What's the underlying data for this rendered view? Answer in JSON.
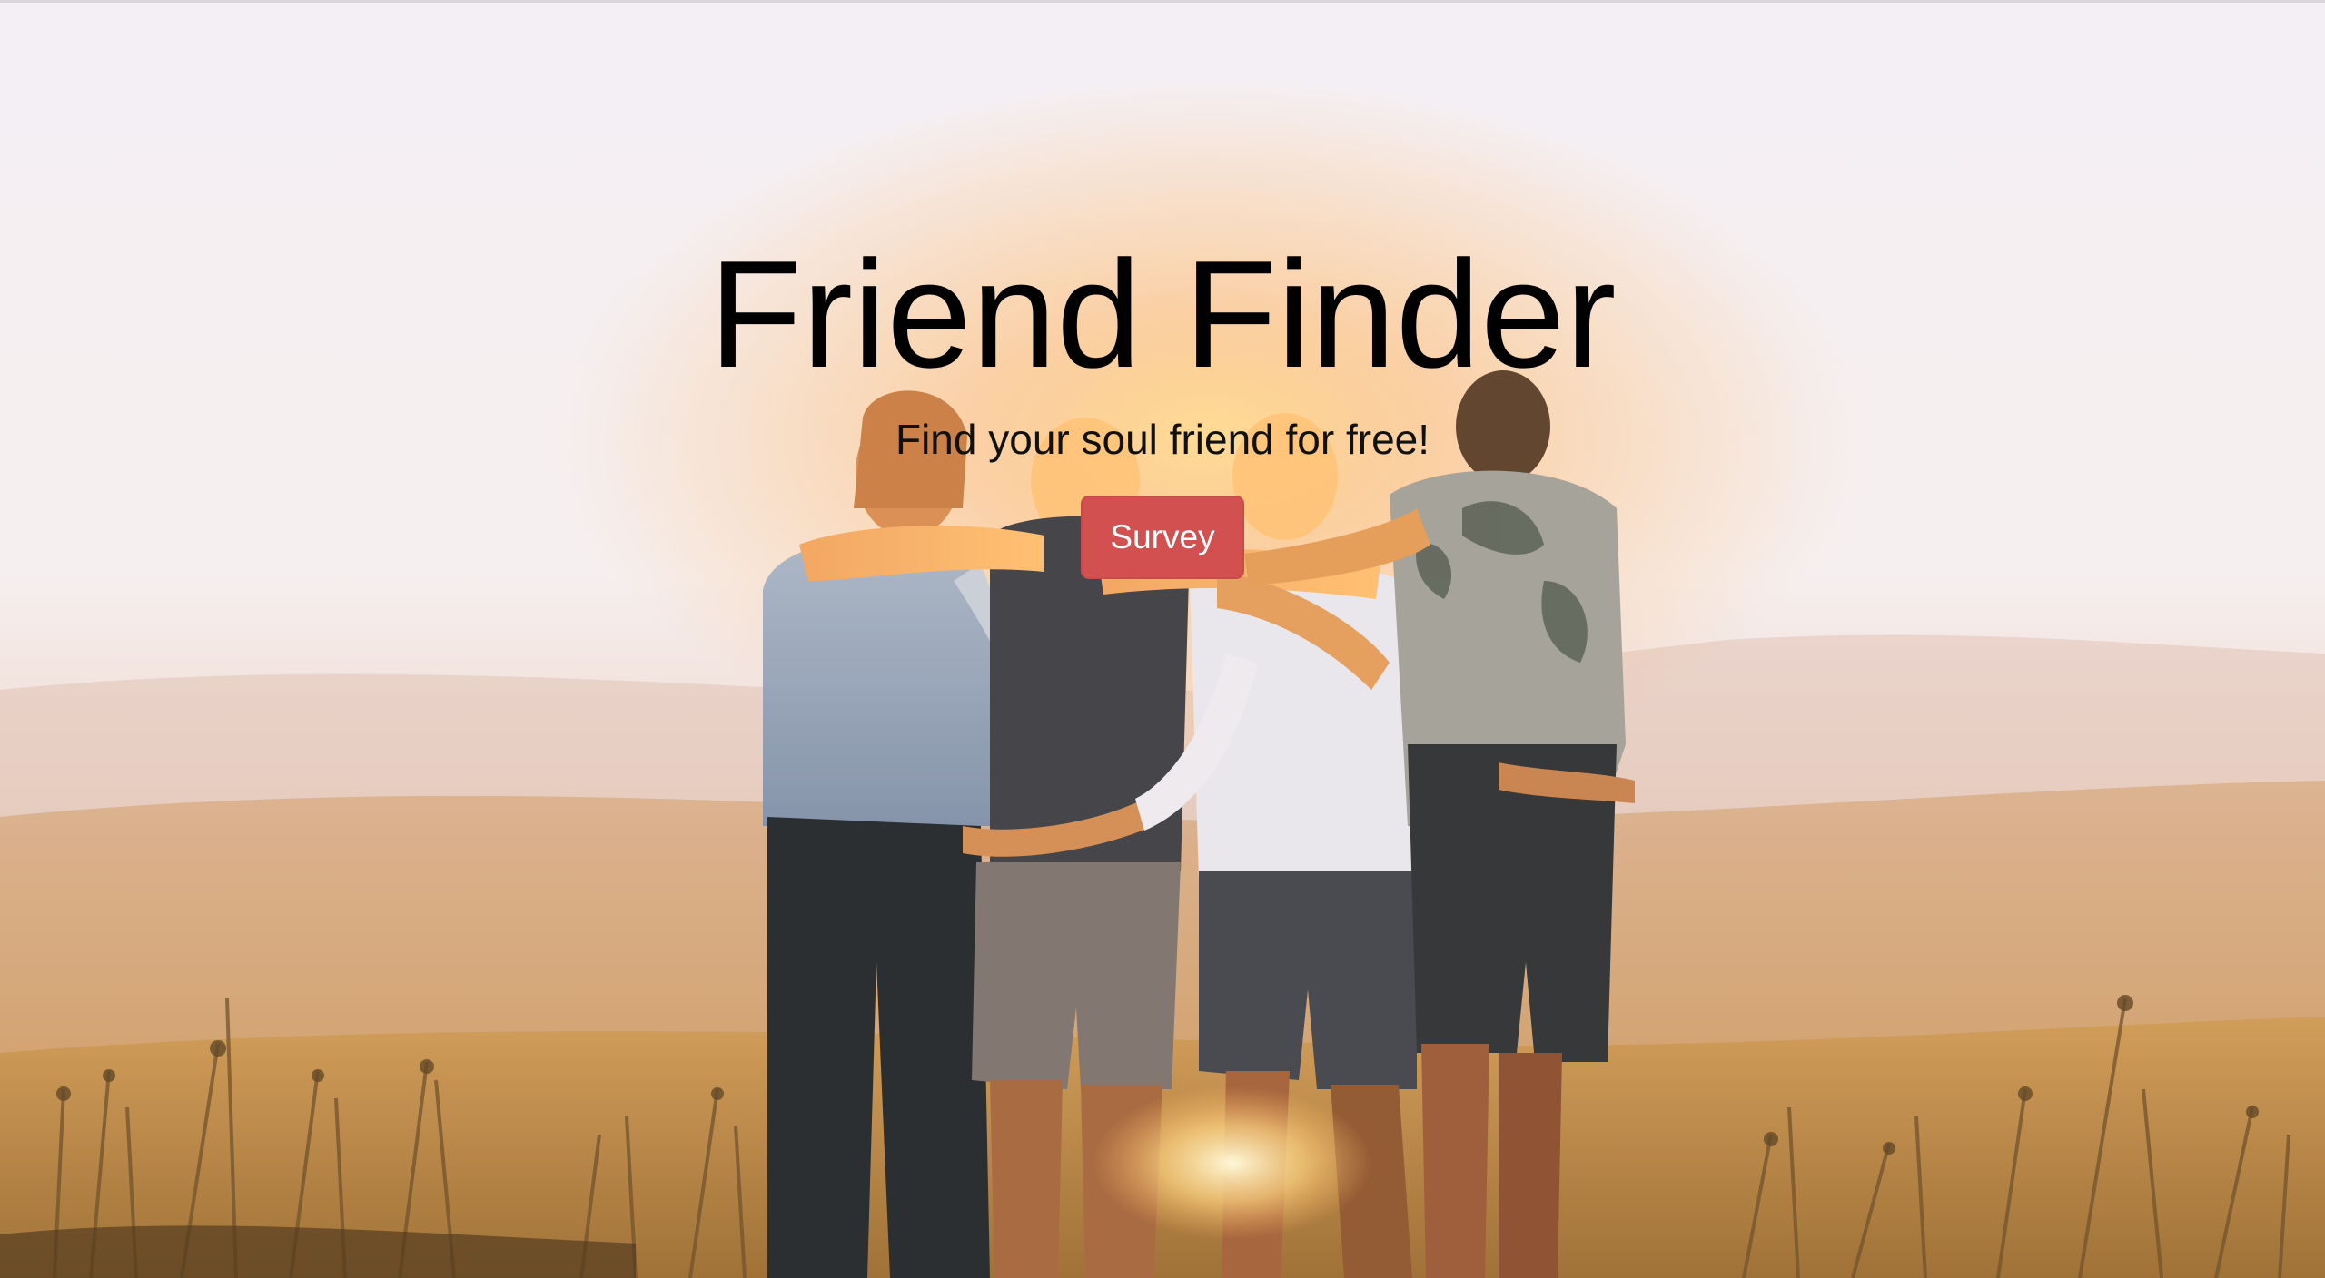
{
  "page": {
    "title": "Friend Finder",
    "subtitle": "Find your soul friend for free!"
  },
  "actions": {
    "survey_label": "Survey"
  },
  "hero_image": {
    "subject": "friends-embracing-at-sunset-photo"
  },
  "colors": {
    "accent": "#d35050",
    "sky": "#f3eef3",
    "sun_glow": "#ffb35c"
  }
}
